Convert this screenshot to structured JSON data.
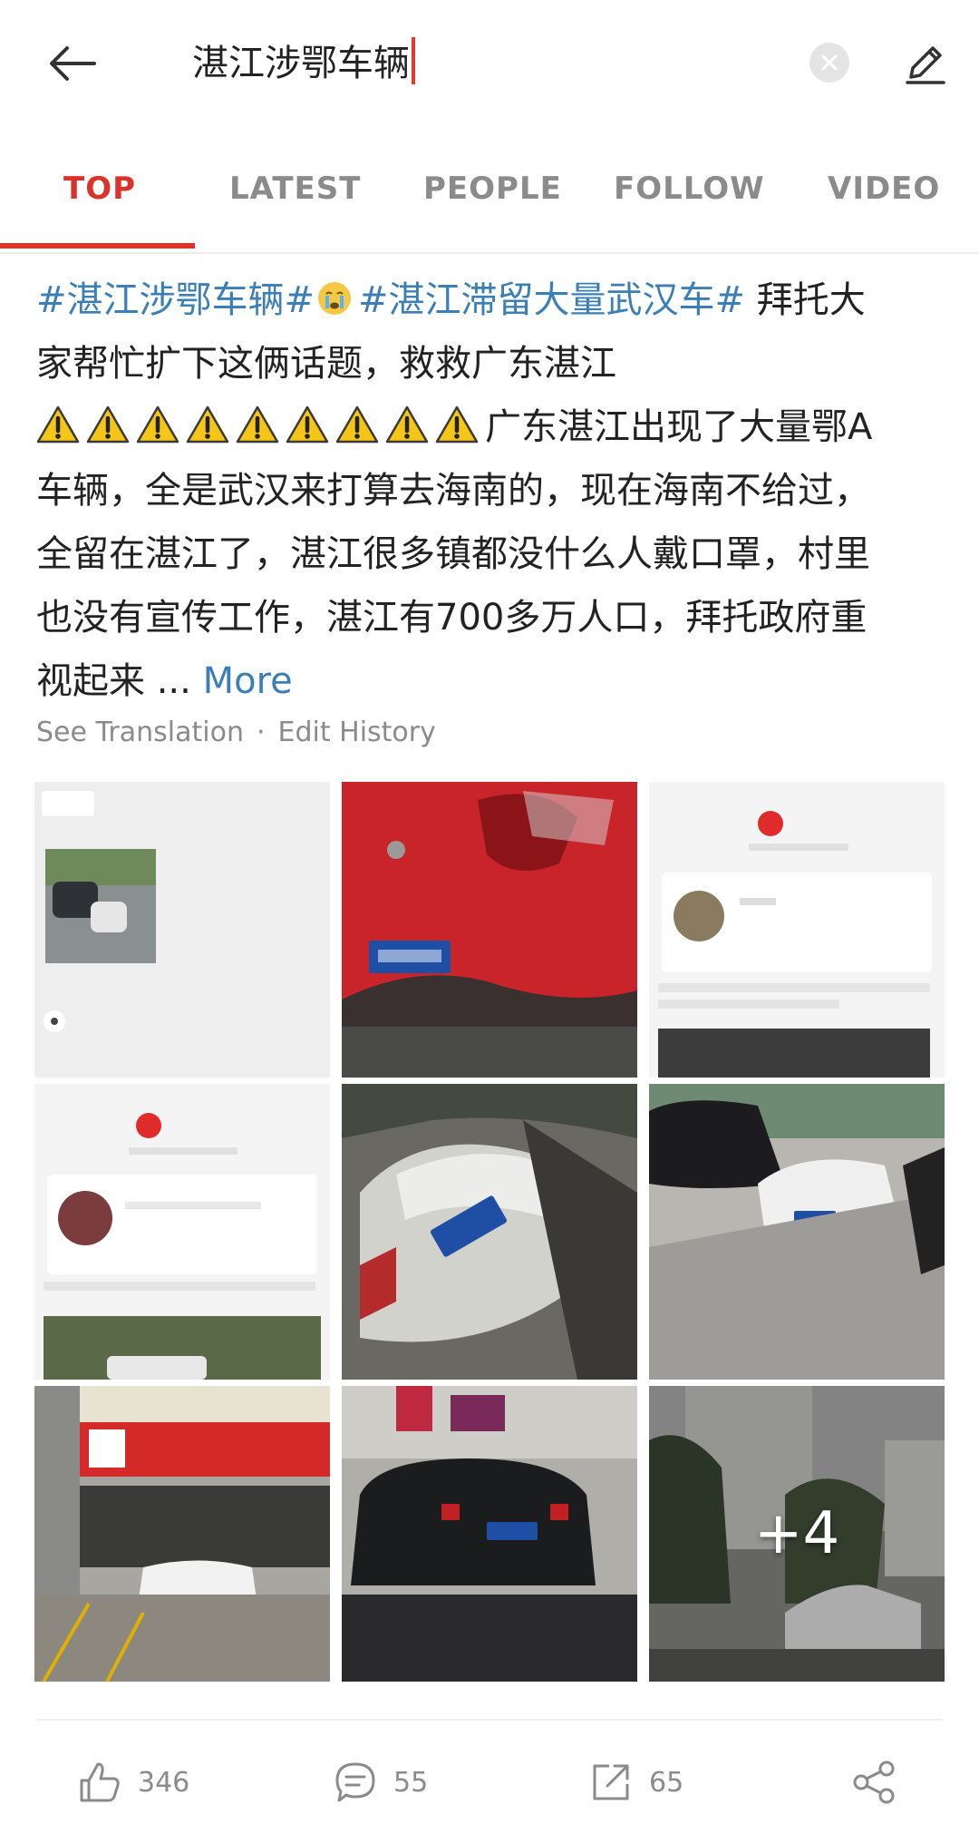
{
  "search": {
    "query": "湛江涉鄂车辆"
  },
  "tabs": [
    {
      "label": "TOP",
      "active": true
    },
    {
      "label": "LATEST"
    },
    {
      "label": "PEOPLE"
    },
    {
      "label": "FOLLOW"
    },
    {
      "label": "VIDEO"
    }
  ],
  "post": {
    "hashtag_1": "#湛江涉鄂车辆#",
    "hashtag_2": "#湛江滞留大量武汉车#",
    "line_1_tail": " 拜托大",
    "line_2": "家帮忙扩下这俩话题，救救广东湛江",
    "line_3_tail": "广东湛江出现了大量鄂A",
    "line_4": "车辆，全是武汉来打算去海南的，现在海南不给过，",
    "line_5": "全留在湛江了，湛江很多镇都没什么人戴口罩，村里",
    "line_6": "也没有宣传工作，湛江有700多万人口，拜托政府重",
    "line_7": "视起来 ... ",
    "more_label": "More",
    "see_translation": "See Translation",
    "meta_separator": "·",
    "edit_history": "Edit History",
    "warning_icon_count": 9
  },
  "images": {
    "overlay_more": "+4"
  },
  "actions": {
    "likes": "346",
    "comments": "55",
    "reposts": "65"
  },
  "colors": {
    "accent": "#d9332b",
    "hashtag": "#3b7fb5",
    "muted": "#8b8b8b"
  }
}
